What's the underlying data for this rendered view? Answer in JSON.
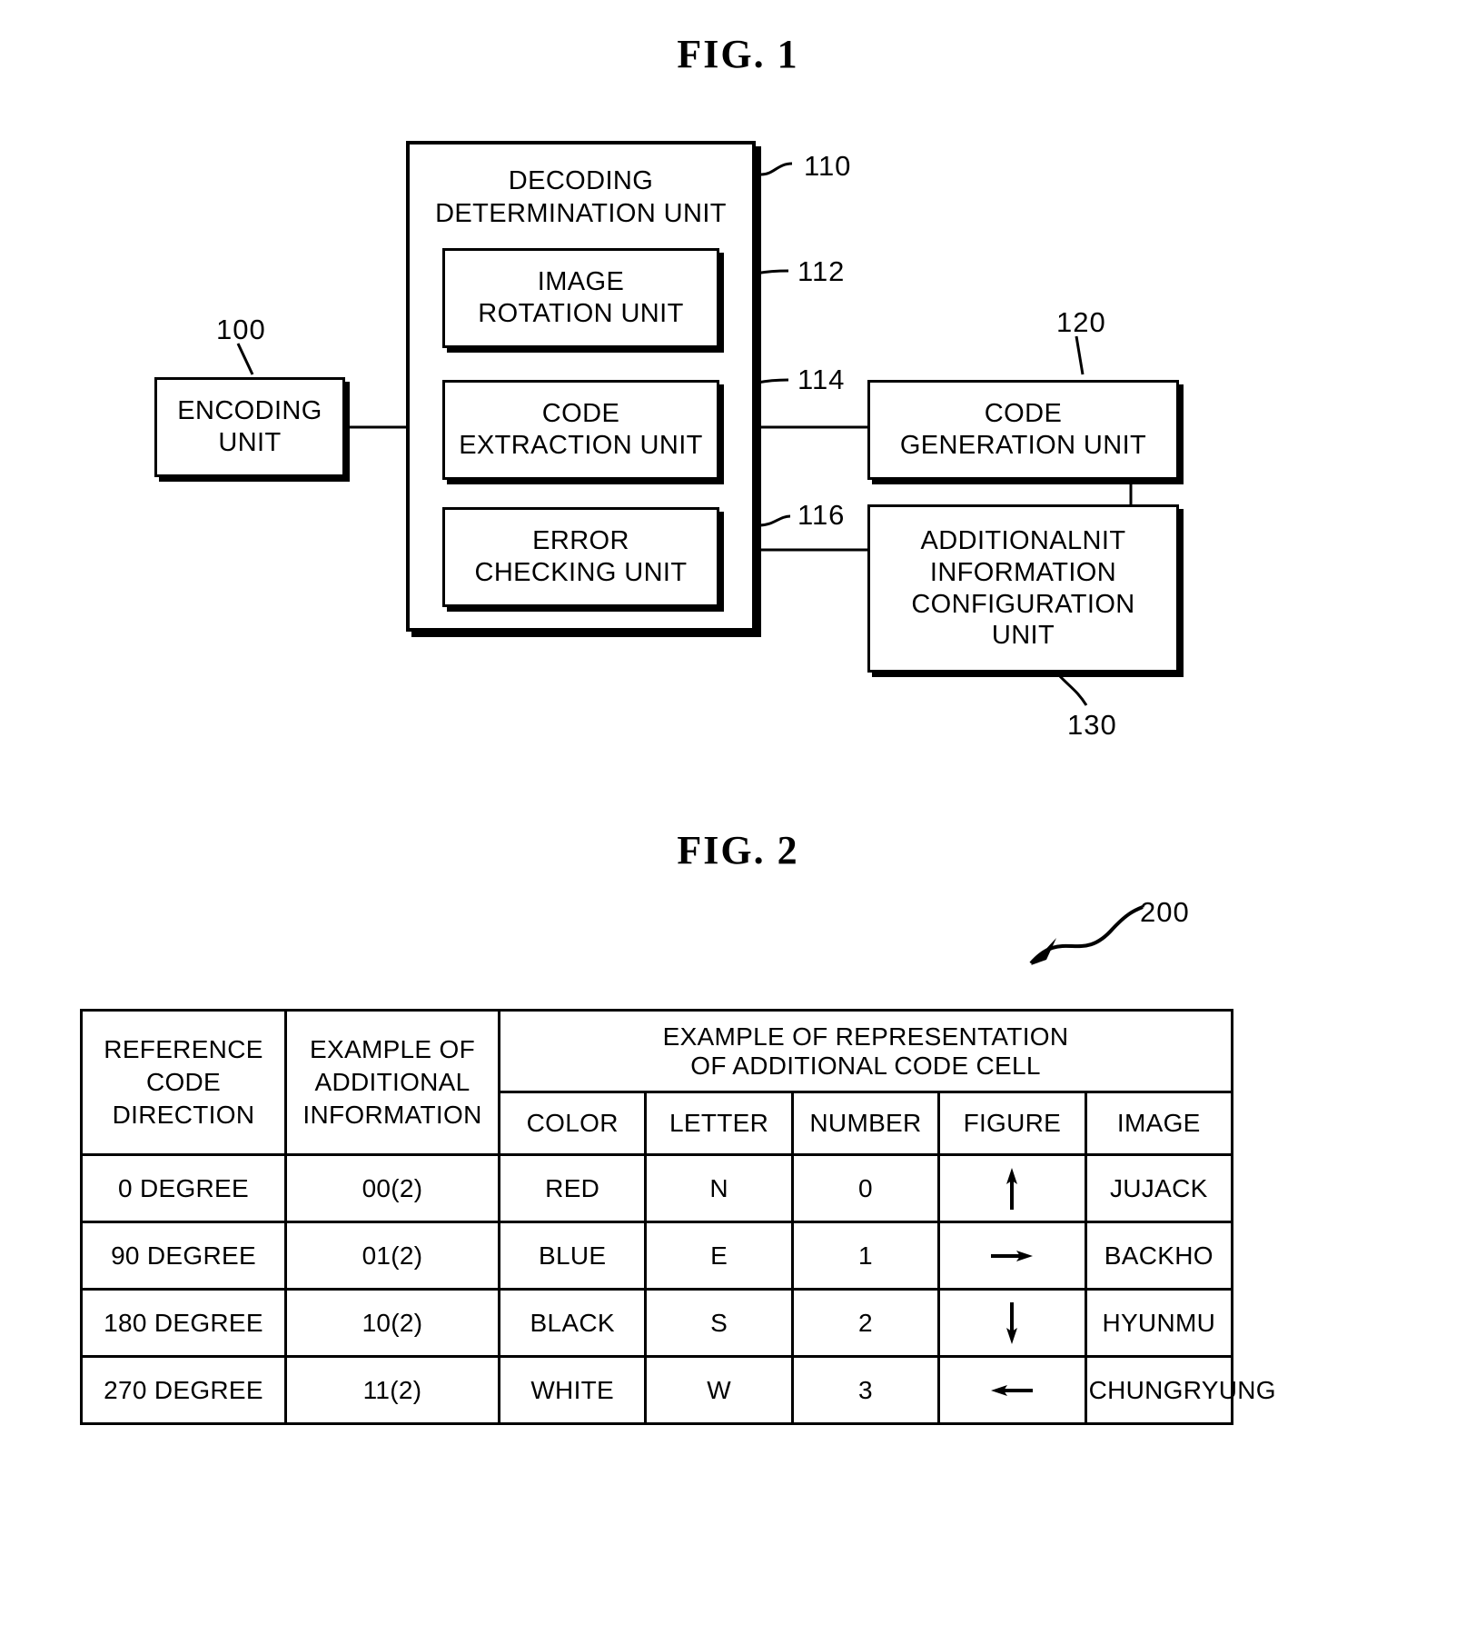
{
  "figures": {
    "fig1": {
      "title": "FIG.  1",
      "blocks": {
        "encoding": {
          "label": "ENCODING\nUNIT",
          "ref": "100"
        },
        "decoding": {
          "label": "DECODING\nDETERMINATION UNIT",
          "ref": "110"
        },
        "rotation": {
          "label": "IMAGE\nROTATION UNIT",
          "ref": "112"
        },
        "extraction": {
          "label": "CODE\nEXTRACTION UNIT",
          "ref": "114"
        },
        "error": {
          "label": "ERROR\nCHECKING UNIT",
          "ref": "116"
        },
        "codegen": {
          "label": "CODE\nGENERATION UNIT",
          "ref": "120"
        },
        "addinfo": {
          "label": "ADDITIONALNIT\nINFORMATION\nCONFIGURATION\nUNIT",
          "ref": "130"
        }
      }
    },
    "fig2": {
      "title": "FIG.  2",
      "ref": "200",
      "table": {
        "headers": {
          "direction": "REFERENCE\nCODE\nDIRECTION",
          "additional": "EXAMPLE OF\nADDITIONAL\nINFORMATION",
          "representation": "EXAMPLE OF REPRESENTATION\nOF ADDITIONAL CODE CELL",
          "sub": [
            "COLOR",
            "LETTER",
            "NUMBER",
            "FIGURE",
            "IMAGE"
          ]
        },
        "rows": [
          {
            "direction": "0 DEGREE",
            "additional": "00(2)",
            "color": "RED",
            "letter": "N",
            "number": "0",
            "figure": "arrow-up",
            "image": "JUJACK"
          },
          {
            "direction": "90 DEGREE",
            "additional": "01(2)",
            "color": "BLUE",
            "letter": "E",
            "number": "1",
            "figure": "arrow-right",
            "image": "BACKHO"
          },
          {
            "direction": "180 DEGREE",
            "additional": "10(2)",
            "color": "BLACK",
            "letter": "S",
            "number": "2",
            "figure": "arrow-down",
            "image": "HYUNMU"
          },
          {
            "direction": "270 DEGREE",
            "additional": "11(2)",
            "color": "WHITE",
            "letter": "W",
            "number": "3",
            "figure": "arrow-left",
            "image": "CHUNGRYUNG"
          }
        ]
      }
    }
  },
  "colors": {
    "ink": "#000000",
    "paper": "#ffffff"
  }
}
